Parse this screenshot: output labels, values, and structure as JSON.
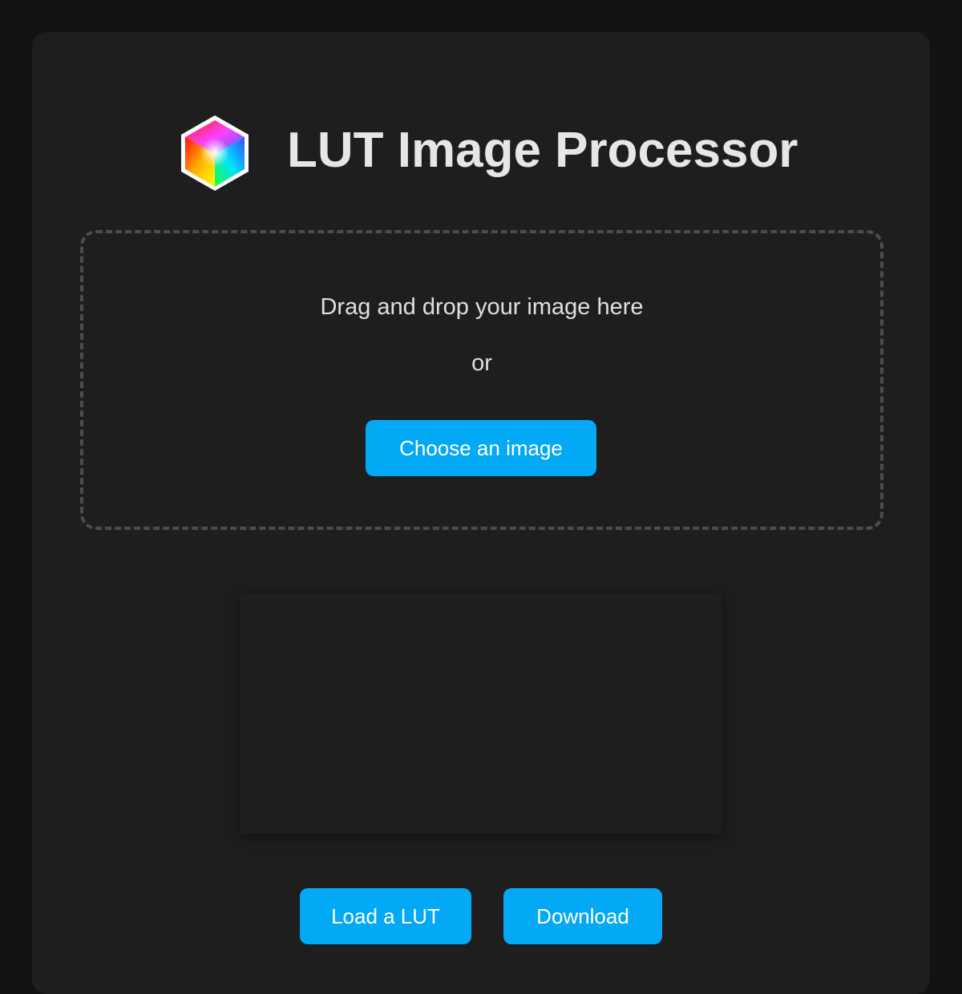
{
  "app": {
    "title": "LUT Image Processor",
    "logo_icon": "rgb-color-cube-icon"
  },
  "dropzone": {
    "instruction": "Drag and drop your image here",
    "separator": "or",
    "choose_label": "Choose an image"
  },
  "actions": {
    "load_lut_label": "Load a LUT",
    "download_label": "Download"
  },
  "colors": {
    "background": "#121212",
    "panel": "#1e1e1e",
    "accent": "#03a9f4",
    "text": "#e6e6e6",
    "dashed_border": "#4d4d4d"
  }
}
